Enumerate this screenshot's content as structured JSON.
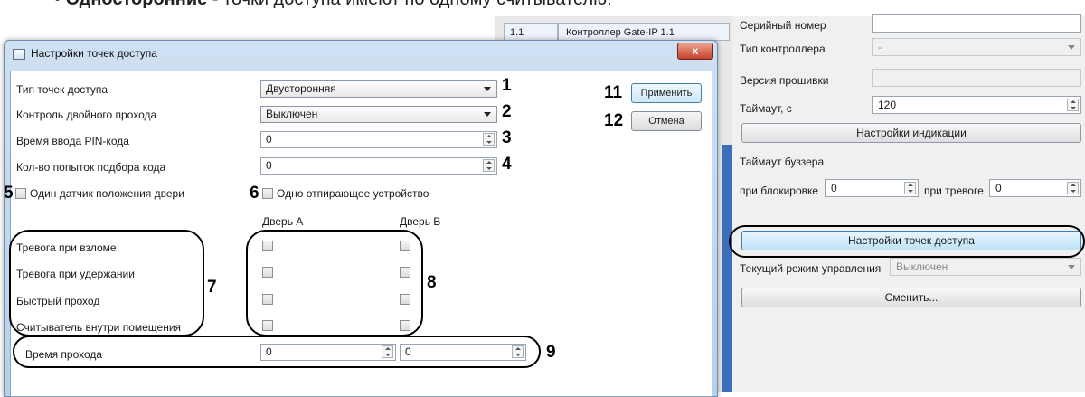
{
  "doc": {
    "bullet": "•",
    "bold_text": "Односторонние",
    "rest_text": " - точки доступа имеют по одному считывателю."
  },
  "bg_window": {
    "row_id": "1.1",
    "row_name": "Контроллер Gate-IP 1.1",
    "serial_label": "Серийный номер",
    "serial_value": "",
    "ctrl_type_label": "Тип контроллера",
    "ctrl_type_value": "-",
    "firmware_label": "Версия прошивки",
    "firmware_value": "",
    "timeout_label": "Таймаут, с",
    "timeout_value": "120",
    "indication_button": "Настройки индикации",
    "buzzer_label": "Таймаут буззера",
    "block_label": "при блокировке",
    "block_value": "0",
    "alarm_label": "при тревоге",
    "alarm_value": "0",
    "ap_settings_button": "Настройки точек доступа",
    "mode_label": "Текущий режим управления",
    "mode_value": "Выключен",
    "change_button": "Сменить..."
  },
  "dialog": {
    "title": "Настройки точек доступа",
    "close": "x",
    "access_type_label": "Тип точек доступа",
    "access_type_value": "Двусторонняя",
    "double_pass_label": "Контроль двойного прохода",
    "double_pass_value": "Выключен",
    "pin_time_label": "Время ввода PIN-кода",
    "pin_time_value": "0",
    "attempts_label": "Кол-во попыток подбора кода",
    "attempts_value": "0",
    "one_sensor_label": "Один датчик положения двери",
    "one_unlock_label": "Одно отпирающее устройство",
    "door_a": "Дверь А",
    "door_b": "Дверь В",
    "rows": [
      "Тревога при взломе",
      "Тревога при удержании",
      "Быстрый проход",
      "Считыватель внутри помещения"
    ],
    "pass_time_label": "Время прохода",
    "pass_time_a": "0",
    "pass_time_b": "0",
    "apply_button": "Применить",
    "cancel_button": "Отмена"
  },
  "markers": [
    "1",
    "2",
    "3",
    "4",
    "5",
    "6",
    "7",
    "8",
    "9",
    "11",
    "12"
  ]
}
